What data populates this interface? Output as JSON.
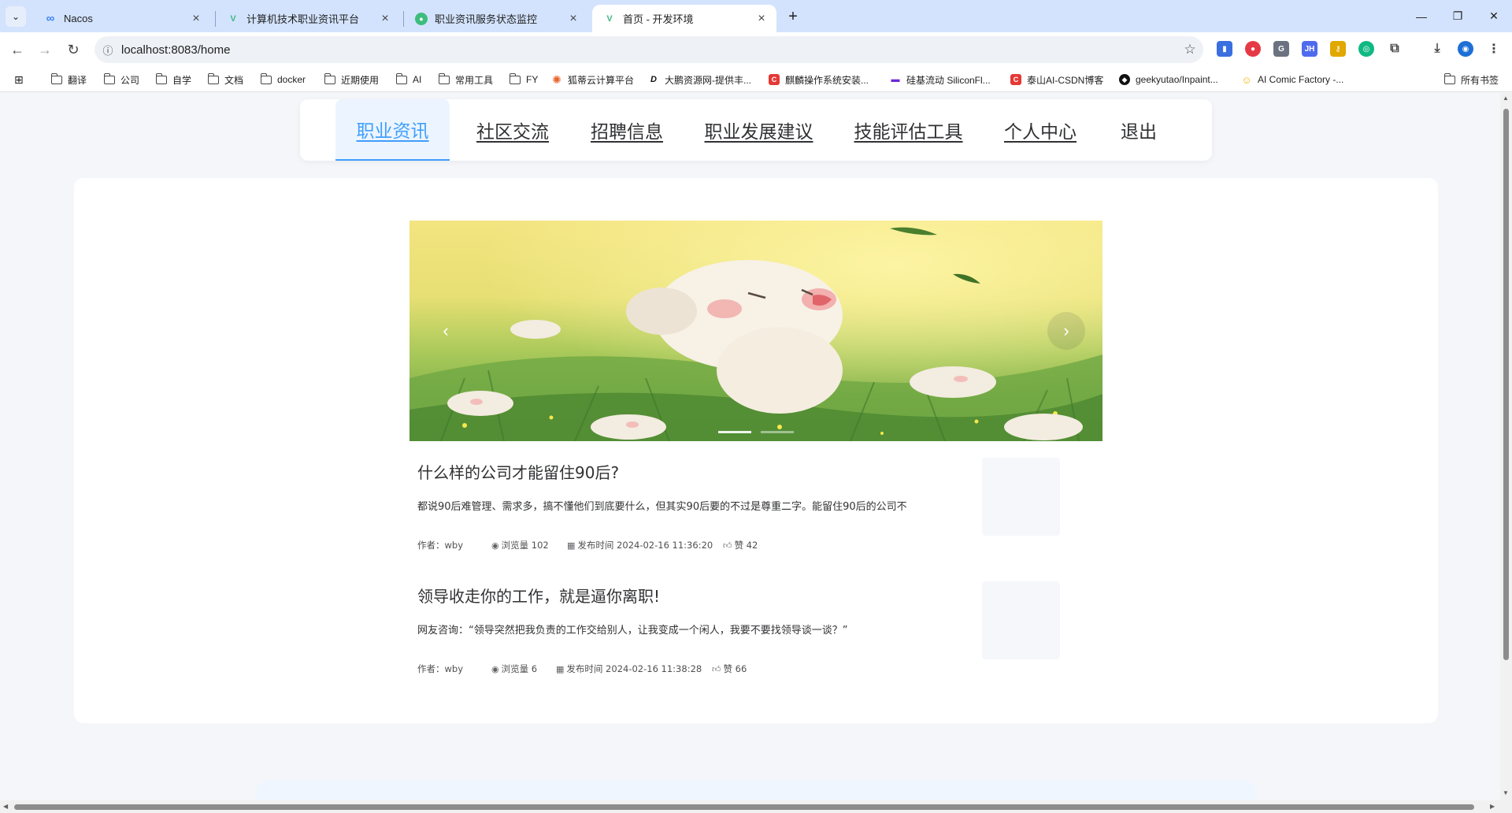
{
  "browser": {
    "tabs": [
      {
        "title": "Nacos",
        "icon": "infinity-icon",
        "active": false
      },
      {
        "title": "计算机技术职业资讯平台",
        "icon": "vue-icon",
        "active": false
      },
      {
        "title": "职业资讯服务状态监控",
        "icon": "monitor-icon",
        "active": false
      },
      {
        "title": "首页 - 开发环境",
        "icon": "vue-icon",
        "active": true
      }
    ],
    "url": "localhost:8083/home",
    "bookmarks": [
      {
        "label": "翻译",
        "type": "folder"
      },
      {
        "label": "公司",
        "type": "folder"
      },
      {
        "label": "自学",
        "type": "folder"
      },
      {
        "label": "文档",
        "type": "folder"
      },
      {
        "label": "docker",
        "type": "folder"
      },
      {
        "label": "近期使用",
        "type": "folder"
      },
      {
        "label": "AI",
        "type": "folder"
      },
      {
        "label": "常用工具",
        "type": "folder"
      },
      {
        "label": "FY",
        "type": "folder"
      },
      {
        "label": "狐蒂云计算平台",
        "type": "site"
      },
      {
        "label": "大鹏资源网-提供丰...",
        "type": "site"
      },
      {
        "label": "麒麟操作系统安装...",
        "type": "site"
      },
      {
        "label": "硅基流动 SiliconFl...",
        "type": "site"
      },
      {
        "label": "泰山AI-CSDN博客",
        "type": "site"
      },
      {
        "label": "geekyutao/Inpaint...",
        "type": "site"
      },
      {
        "label": "AI Comic Factory -...",
        "type": "site"
      }
    ],
    "all_bookmarks": "所有书签"
  },
  "nav": {
    "items": [
      {
        "label": "职业资讯",
        "active": true
      },
      {
        "label": "社区交流",
        "active": false
      },
      {
        "label": "招聘信息",
        "active": false
      },
      {
        "label": "职业发展建议",
        "active": false
      },
      {
        "label": "技能评估工具",
        "active": false
      },
      {
        "label": "个人中心",
        "active": false
      },
      {
        "label": "退出",
        "active": false
      }
    ]
  },
  "articles": [
    {
      "title": "什么样的公司才能留住90后?",
      "summary": "都说90后难管理、需求多，搞不懂他们到底要什么，但其实90后要的不过是尊重二字。能留住90后的公司不",
      "author": "作者：wby",
      "views": "浏览量 102",
      "published": "发布时间 2024-02-16 11:36:20",
      "likes": "赞 42"
    },
    {
      "title": "领导收走你的工作，就是逼你离职!",
      "summary": " 网友咨询：“领导突然把我负责的工作交给别人，让我变成一个闲人，我要不要找领导谈一谈？”",
      "author": "作者：wby",
      "views": "浏览量 6",
      "published": "发布时间 2024-02-16 11:38:28",
      "likes": "赞 66"
    }
  ],
  "carousel": {
    "slide_count": 2,
    "current": 1
  }
}
